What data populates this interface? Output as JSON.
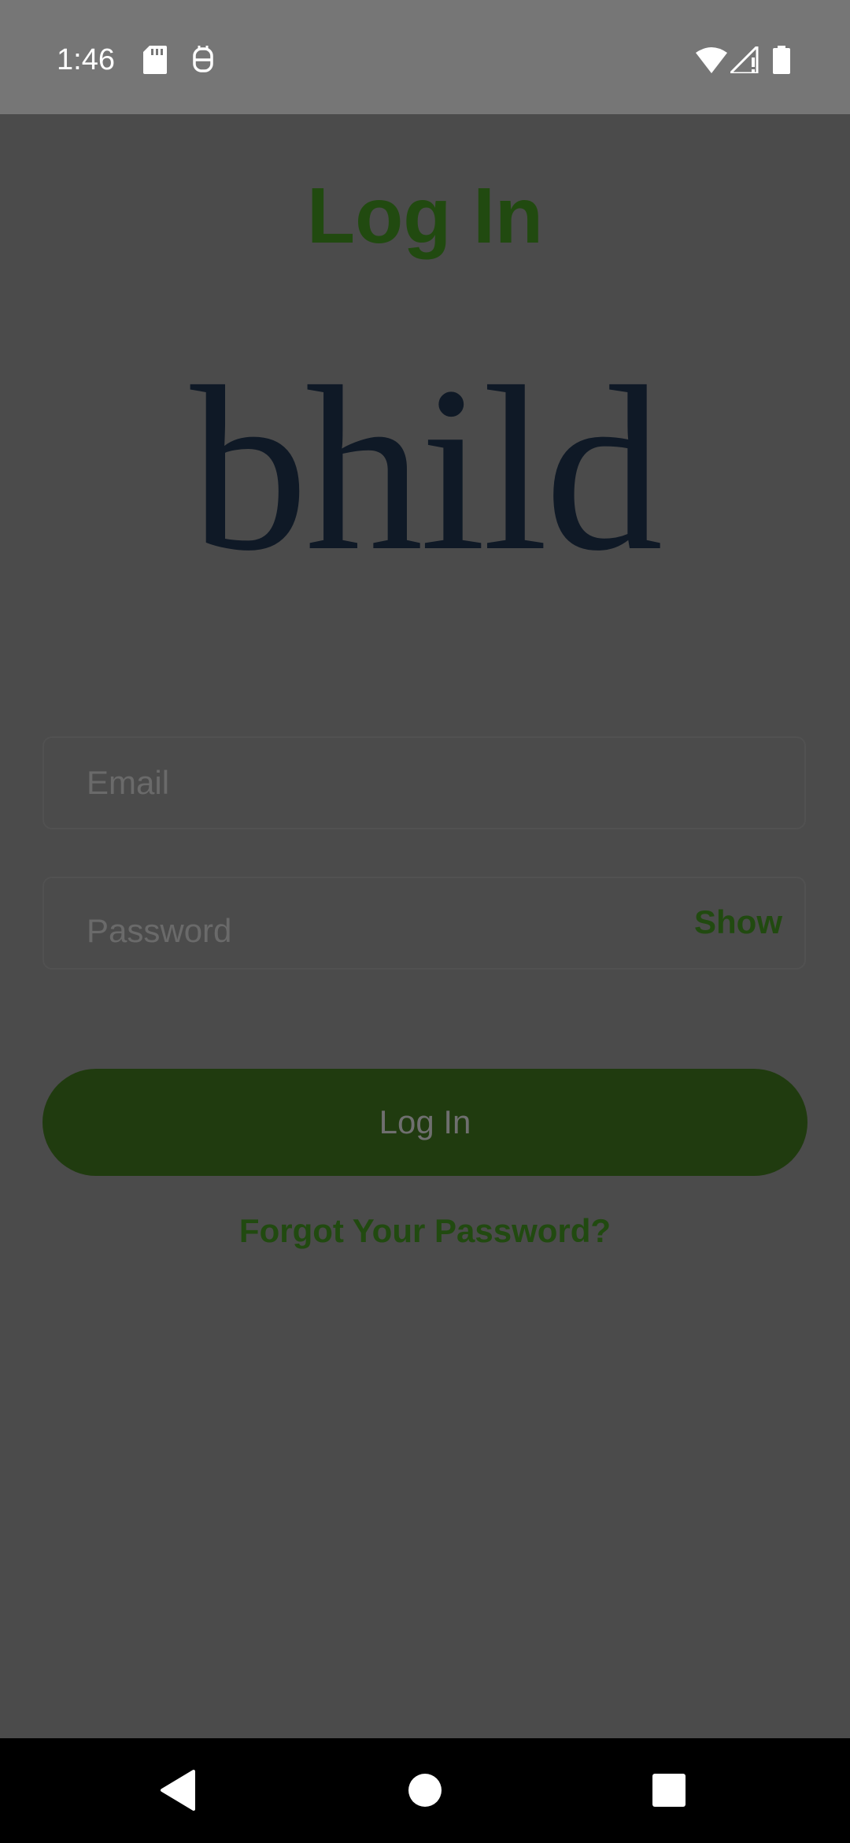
{
  "status_bar": {
    "time": "1:46",
    "icons": [
      "sd-card-icon",
      "notification-icon",
      "wifi-icon",
      "signal-icon",
      "battery-icon"
    ]
  },
  "page": {
    "title": "Log In",
    "logo_text": "bhild"
  },
  "form": {
    "email": {
      "placeholder": "Email",
      "value": ""
    },
    "password": {
      "placeholder": "Password",
      "value": "",
      "toggle_label": "Show"
    },
    "submit_label": "Log In",
    "forgot_label": "Forgot Your Password?"
  },
  "nav_bar": {
    "buttons": [
      "back-icon",
      "home-icon",
      "recents-icon"
    ]
  },
  "colors": {
    "accent": "#214a10",
    "button_bg": "#203b0f",
    "overlay_bg": "#4b4b4b",
    "status_bar_bg": "#767676",
    "logo": "#0f1926"
  }
}
